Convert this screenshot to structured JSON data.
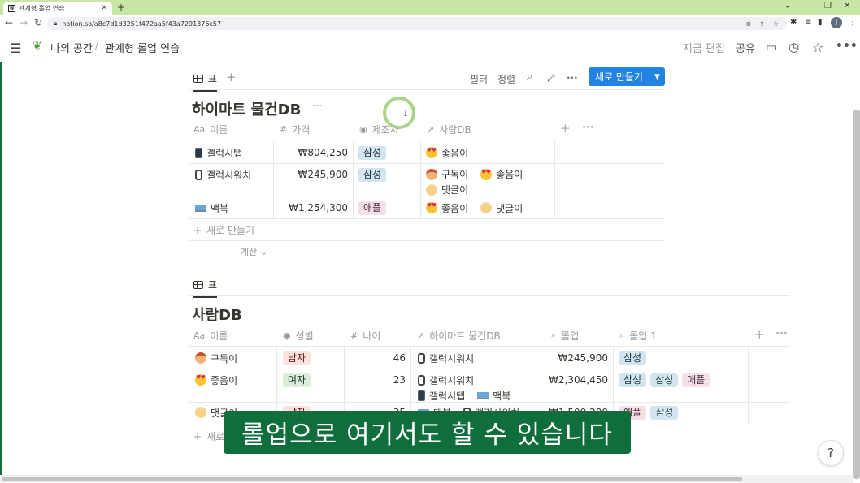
{
  "browser": {
    "tab_title": "관계형 롤업 연습",
    "url": "notion.so/a8c7d1d3251f472aa5f43a7291376c57",
    "profile_initial": "J"
  },
  "topbar": {
    "workspace": "나의 공간",
    "separator": "/",
    "page": "관계형 롤업 연습",
    "edit_label": "지금 편집",
    "share_label": "공유"
  },
  "toolbar": {
    "view_label": "표",
    "filter_label": "필터",
    "sort_label": "정렬",
    "new_label": "새로 만들기"
  },
  "db1": {
    "title": "하이마트 물건DB",
    "columns": [
      {
        "icon": "Aa",
        "label": "이름"
      },
      {
        "icon": "#",
        "label": "가격"
      },
      {
        "icon": "◉",
        "label": "제조사"
      },
      {
        "icon": "↗",
        "label": "사람DB"
      }
    ],
    "rows": [
      {
        "name": "갤럭시탭",
        "device": "phone",
        "price": "₩804,250",
        "maker": "삼성",
        "people": [
          {
            "emoji": "love",
            "name": "좋음이"
          }
        ]
      },
      {
        "name": "갤럭시워치",
        "device": "watch",
        "price": "₩245,900",
        "maker": "삼성",
        "people": [
          {
            "emoji": "kid",
            "name": "구독이"
          },
          {
            "emoji": "love",
            "name": "좋음이"
          },
          {
            "emoji": "baby",
            "name": "댓글이"
          }
        ]
      },
      {
        "name": "맥북",
        "device": "laptop",
        "price": "₩1,254,300",
        "maker": "애플",
        "people": [
          {
            "emoji": "love",
            "name": "좋음이"
          },
          {
            "emoji": "baby",
            "name": "댓글이"
          }
        ]
      }
    ],
    "new_row": "새로 만들기",
    "calc": "계산"
  },
  "db2": {
    "view_label": "표",
    "title": "사람DB",
    "columns": [
      {
        "icon": "Aa",
        "label": "이름"
      },
      {
        "icon": "◉",
        "label": "성별"
      },
      {
        "icon": "#",
        "label": "나이"
      },
      {
        "icon": "↗",
        "label": "하이마트 물건DB"
      },
      {
        "icon": "⌕",
        "label": "롤업"
      },
      {
        "icon": "⌕",
        "label": "롤업 1"
      }
    ],
    "rows": [
      {
        "name": "구독이",
        "emoji": "kid",
        "gender": "남자",
        "age": "46",
        "items": [
          {
            "device": "watch",
            "name": "갤럭시워치"
          }
        ],
        "rollup": "₩245,900",
        "rollup1": [
          "삼성"
        ]
      },
      {
        "name": "좋음이",
        "emoji": "love",
        "gender": "여자",
        "age": "23",
        "items": [
          {
            "device": "watch",
            "name": "갤럭시워치"
          },
          {
            "device": "phone",
            "name": "갤럭시탭"
          },
          {
            "device": "laptop",
            "name": "맥북"
          }
        ],
        "rollup": "₩2,304,450",
        "rollup1": [
          "삼성",
          "삼성",
          "애플"
        ]
      },
      {
        "name": "댓글이",
        "emoji": "baby",
        "gender": "남자",
        "age": "35",
        "items": [
          {
            "device": "laptop",
            "name": "맥북"
          },
          {
            "device": "watch",
            "name": "갤럭시워치"
          }
        ],
        "rollup": "₩1,500,200",
        "rollup1": [
          "애플",
          "삼성"
        ]
      }
    ],
    "new_row": "새로"
  },
  "subtitle": "롤업으로 여기서도 할 수 있습니다",
  "help_label": "?"
}
